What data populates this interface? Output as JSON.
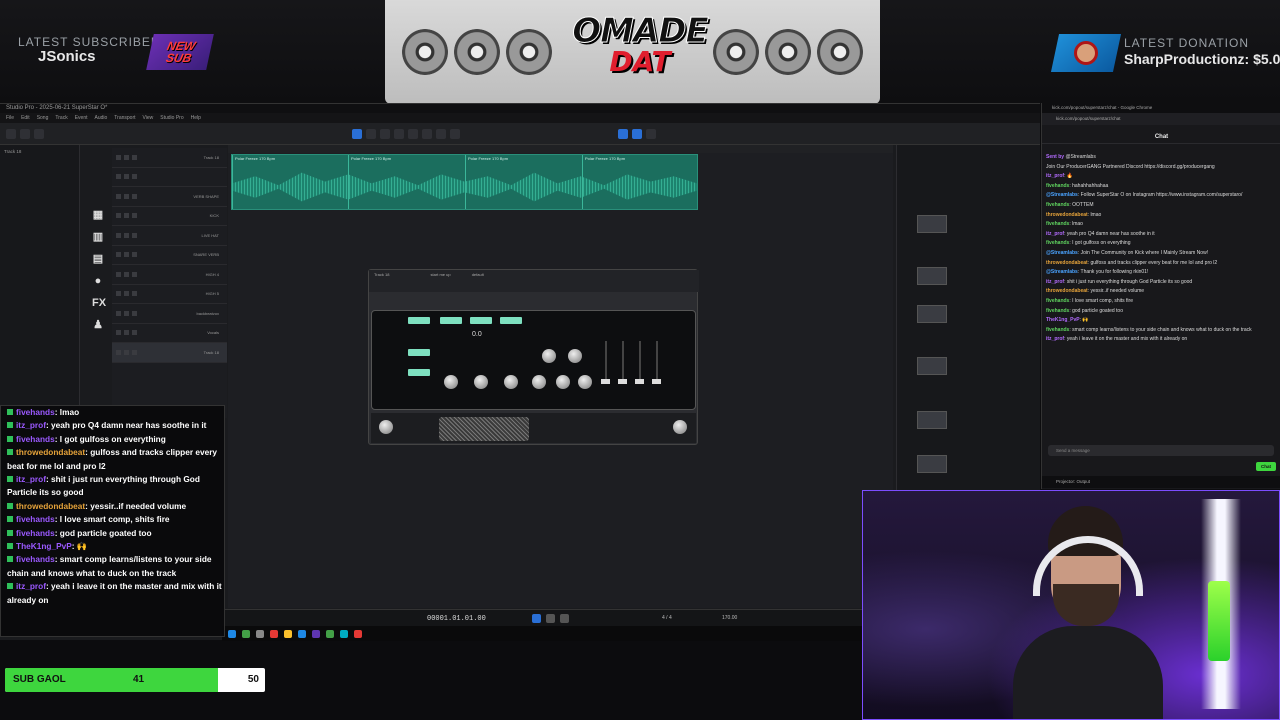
{
  "overlay": {
    "latest_subscriber_label": "LATEST SUBSCRIBER",
    "latest_subscriber_name": "JSonics",
    "new_sub_badge_line1": "NEW",
    "new_sub_badge_line2": "SUB",
    "logo_line1": "OMADE",
    "logo_line2": "DAT",
    "latest_donation_label": "LATEST DONATION",
    "latest_donation_value": "SharpProductionz: $5.0"
  },
  "daw": {
    "title": "Studio Pro - 2025-06-21 SuperStar O*",
    "menu": [
      "File",
      "Edit",
      "Song",
      "Track",
      "Event",
      "Audio",
      "Transport",
      "View",
      "Studio Pro",
      "Help"
    ],
    "clip_name": "Polar Freeze 170 Bpm",
    "tracks": [
      "Track 18",
      "",
      "VERB SHAPE",
      "KICK",
      "LIVE HAT",
      "SNARE VERB",
      "HIGH 4",
      "HIGH 5",
      "backbeatvox",
      "Vocals",
      "Track 18"
    ],
    "plugin_track": "Track 18",
    "plugin_preset": "start me up",
    "plugin_default": "default",
    "plugin_gain_value": "0.0",
    "timecode": "00001.01.01.00",
    "tempo": "170.00",
    "timesig": "4 / 4"
  },
  "chat_overlay": {
    "messages": [
      {
        "user": "fivehands",
        "cls": "u",
        "text": ": lmao"
      },
      {
        "user": "itz_prof",
        "cls": "u",
        "text": ": yeah pro Q4 damn near has soothe in it"
      },
      {
        "user": "fivehands",
        "cls": "u",
        "text": ": I got gulfoss on everything"
      },
      {
        "user": "throwedondabeat",
        "cls": "u o",
        "text": ": gulfoss and tracks clipper every beat for me lol and pro l2"
      },
      {
        "user": "itz_prof",
        "cls": "u",
        "text": ": shit i just run everything through God Particle its so good"
      },
      {
        "user": "throwedondabeat",
        "cls": "u o",
        "text": ": yessir..if needed volume"
      },
      {
        "user": "fivehands",
        "cls": "u",
        "text": ": I love smart comp, shits fire"
      },
      {
        "user": "fivehands",
        "cls": "u",
        "text": ": god particle goated too"
      },
      {
        "user": "TheK1ng_PvP",
        "cls": "u",
        "text": ": 🙌"
      },
      {
        "user": "fivehands",
        "cls": "u",
        "text": ": smart comp learns/listens to your side chain and knows what to duck on the track"
      },
      {
        "user": "itz_prof",
        "cls": "u",
        "text": ": yeah i leave it on the master and mix with it already on"
      }
    ]
  },
  "sub_goal": {
    "label": "SUB GAOL",
    "current": "41",
    "target": "50",
    "fraction": 0.82
  },
  "chat_window": {
    "window_title": "kick.com/popout/superstarz/chat - Google Chrome",
    "url": "kick.com/popout/superstarz/chat",
    "header": "Chat",
    "input_placeholder": "Send a message",
    "send_label": "Chat",
    "projector_label": "Projector: Output",
    "lines": [
      {
        "user": "Sent by",
        "cls": "u",
        "text": " @Streamlabs"
      },
      {
        "user": "",
        "cls": "u",
        "text": "Join Our ProducerGANG Partnered Discord https://discord.gg/producergang"
      },
      {
        "user": "itz_prof",
        "cls": "u",
        "text": ": 🔥"
      },
      {
        "user": "fivehands",
        "cls": "u g",
        "text": ": hahahhahhahaa"
      },
      {
        "user": "@Streamlabs",
        "cls": "u b",
        "text": ": Follow SuperStar O on Instagram https://www.instagram.com/superstaro/"
      },
      {
        "user": "fivehands",
        "cls": "u g",
        "text": ": OOTTEM"
      },
      {
        "user": "throwedondabeat",
        "cls": "u o",
        "text": ": lmao"
      },
      {
        "user": "fivehands",
        "cls": "u g",
        "text": ": lmao"
      },
      {
        "user": "itz_prof",
        "cls": "u",
        "text": ": yeah pro Q4 damn near has soothe in it"
      },
      {
        "user": "fivehands",
        "cls": "u g",
        "text": ": I got gulfoss on everything"
      },
      {
        "user": "@Streamlabs",
        "cls": "u b",
        "text": ": Join The Community on Kick where I Mainly Stream Now!"
      },
      {
        "user": "throwedondabeat",
        "cls": "u o",
        "text": ": gulfoss and tracks clipper every beat for me lol and pro l2"
      },
      {
        "user": "@Streamlabs",
        "cls": "u b",
        "text": ": Thank you for following rkin01!"
      },
      {
        "user": "itz_prof",
        "cls": "u",
        "text": ": shit i just run everything through God Particle its so good"
      },
      {
        "user": "throwedondabeat",
        "cls": "u o",
        "text": ": yessir..if needed volume"
      },
      {
        "user": "fivehands",
        "cls": "u g",
        "text": ": I love smart comp, shits fire"
      },
      {
        "user": "fivehands",
        "cls": "u g",
        "text": ": god particle goated too"
      },
      {
        "user": "TheK1ng_PvP",
        "cls": "u",
        "text": ": 🙌"
      },
      {
        "user": "fivehands",
        "cls": "u g",
        "text": ": smart comp learns/listens to your side chain and knows what to duck on the track"
      },
      {
        "user": "itz_prof",
        "cls": "u",
        "text": ": yeah i leave it on the master and mix with it already on"
      }
    ]
  }
}
